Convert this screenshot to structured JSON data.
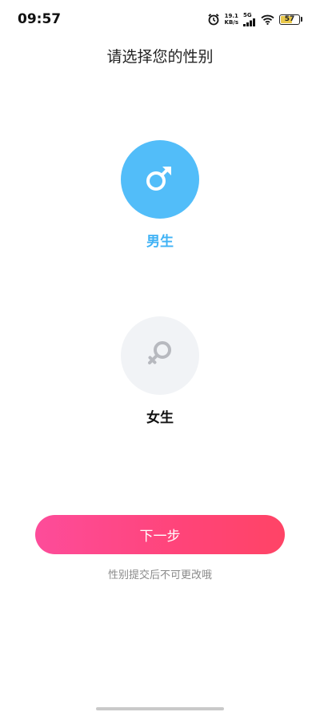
{
  "status_bar": {
    "time": "09:57",
    "net_speed_value": "19.1",
    "net_speed_unit": "KB/s",
    "network_type": "5G",
    "battery_level": "57"
  },
  "title": "请选择您的性别",
  "options": [
    {
      "label": "男生",
      "icon": "male-symbol-icon",
      "selected": true,
      "color": "#52bdf9"
    },
    {
      "label": "女生",
      "icon": "female-symbol-icon",
      "selected": false,
      "color": "#f1f3f6"
    }
  ],
  "next_button_label": "下一步",
  "hint": "性别提交后不可更改哦",
  "colors": {
    "accent_blue": "#52bdf9",
    "button_gradient_start": "#fd4c9a",
    "button_gradient_end": "#ff4466"
  }
}
